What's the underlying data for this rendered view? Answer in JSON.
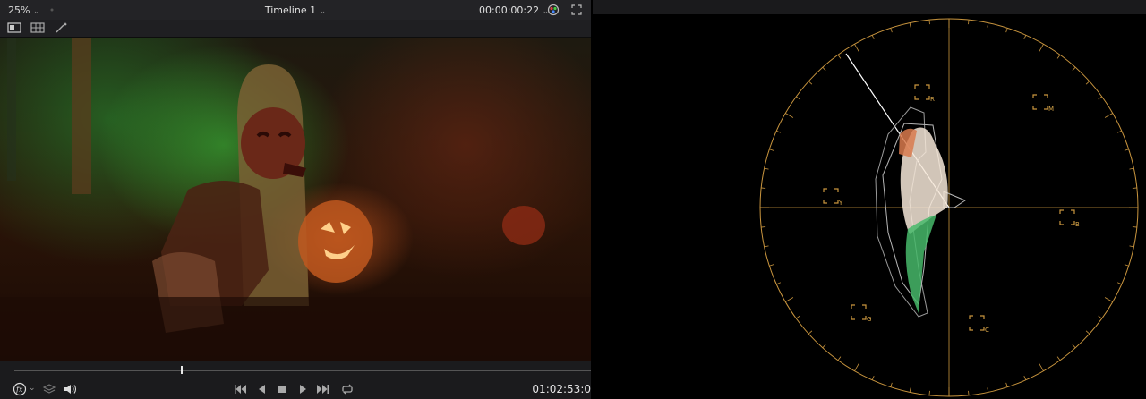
{
  "viewer": {
    "zoom": "25%",
    "timeline_title": "Timeline 1",
    "source_timecode": "00:00:00:22",
    "playhead_timecode": "01:02:53:0",
    "playhead_fraction": 0.29
  },
  "scope": {
    "type": "vectorscope",
    "targets": [
      {
        "label": "R"
      },
      {
        "label": "M"
      },
      {
        "label": "B"
      },
      {
        "label": "C"
      },
      {
        "label": "G"
      },
      {
        "label": "Y"
      }
    ]
  },
  "colors": {
    "graticule": "#c9953e",
    "panel": "#1b1b1d"
  }
}
